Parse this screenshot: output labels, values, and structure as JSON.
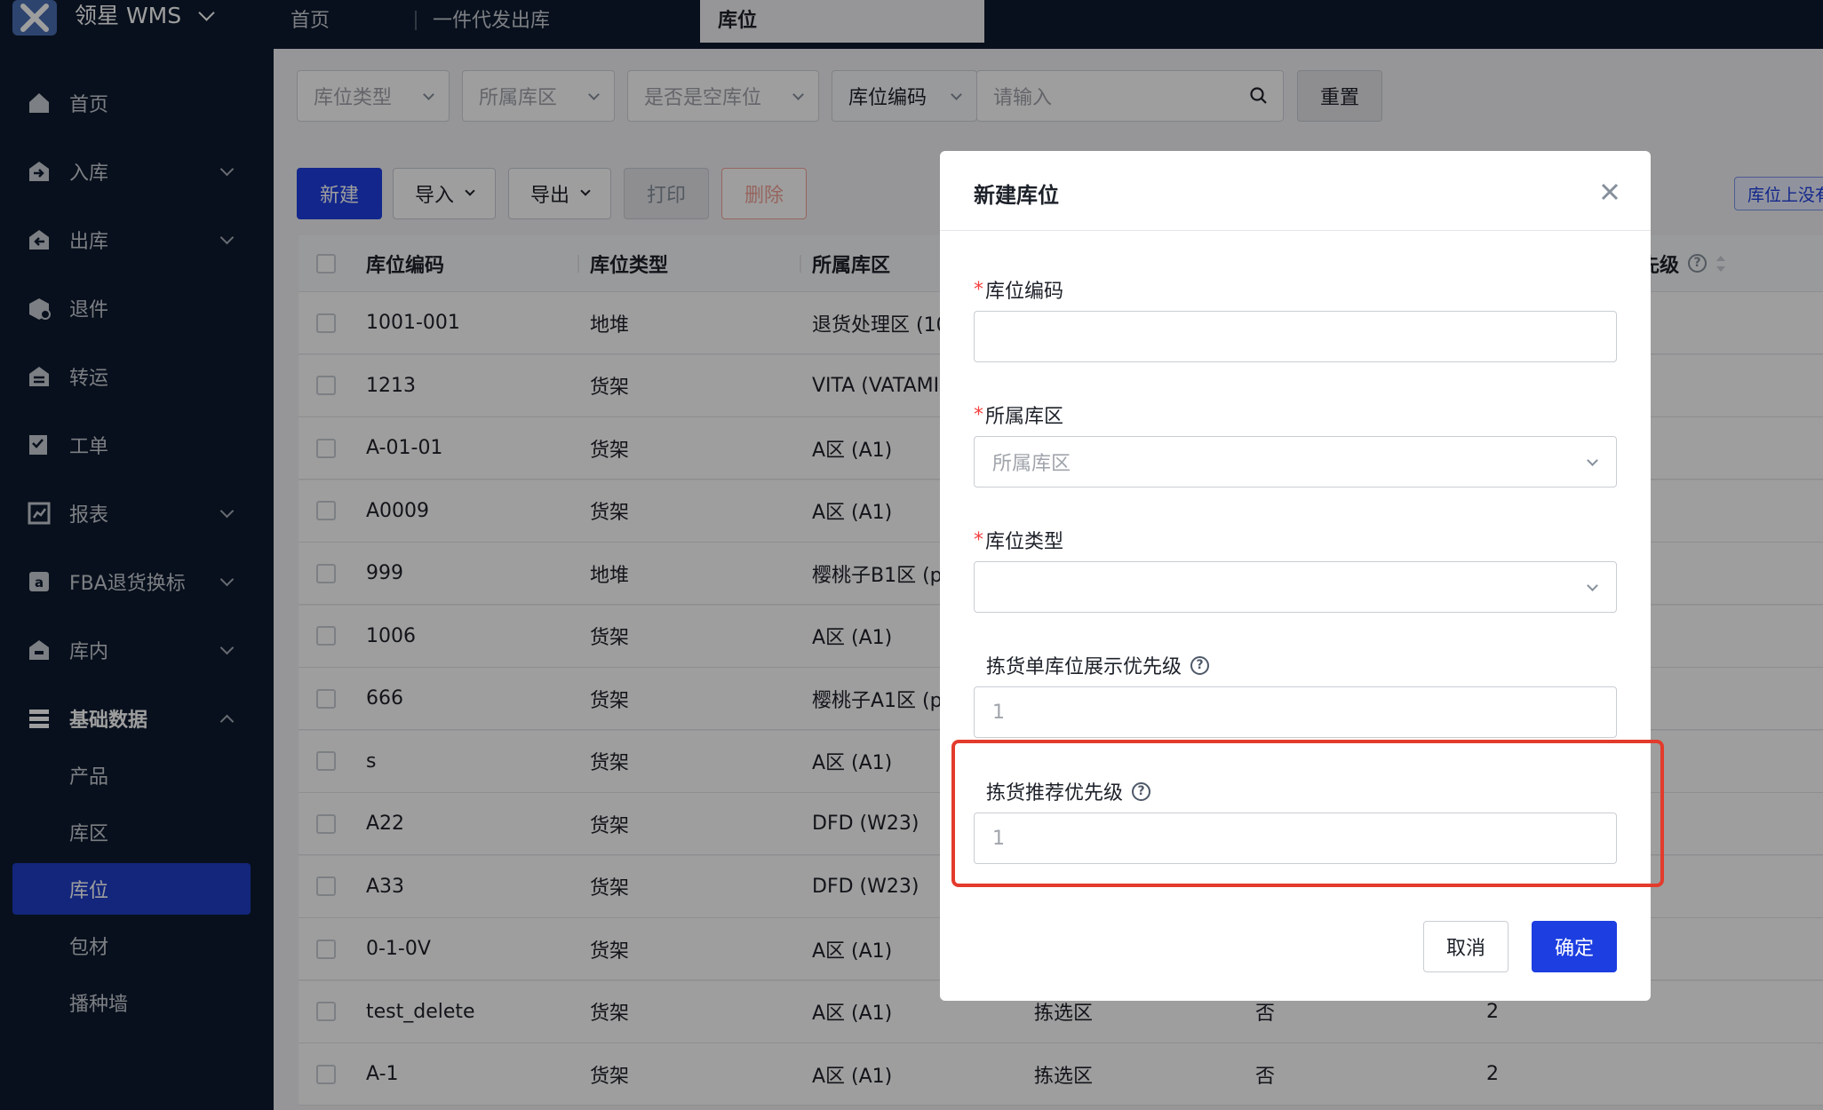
{
  "app": {
    "name": "领星 WMS"
  },
  "top_tabs": [
    {
      "label": "首页"
    },
    {
      "label": "一件代发出库"
    },
    {
      "label": "库位"
    }
  ],
  "sidebar": {
    "items": [
      {
        "label": "首页",
        "icon": "home-icon",
        "has_arrow": false
      },
      {
        "label": "入库",
        "icon": "inbound-icon",
        "has_arrow": true
      },
      {
        "label": "出库",
        "icon": "outbound-icon",
        "has_arrow": true
      },
      {
        "label": "退件",
        "icon": "return-icon",
        "has_arrow": false
      },
      {
        "label": "转运",
        "icon": "transfer-icon",
        "has_arrow": false
      },
      {
        "label": "工单",
        "icon": "workorder-icon",
        "has_arrow": false
      },
      {
        "label": "报表",
        "icon": "report-icon",
        "has_arrow": true
      },
      {
        "label": "FBA退货换标",
        "icon": "amazon-icon",
        "has_arrow": true
      },
      {
        "label": "库内",
        "icon": "warehouse-icon",
        "has_arrow": true
      },
      {
        "label": "基础数据",
        "icon": "basic-data-icon",
        "has_arrow": true
      }
    ],
    "sub_items": [
      {
        "label": "产品"
      },
      {
        "label": "库区"
      },
      {
        "label": "库位"
      },
      {
        "label": "包材"
      },
      {
        "label": "播种墙"
      }
    ]
  },
  "filters": {
    "location_type": "库位类型",
    "zone": "所属库区",
    "is_empty": "是否是空库位",
    "code_select": "库位编码",
    "search_placeholder": "请输入",
    "reset": "重置"
  },
  "toolbar": {
    "new": "新建",
    "import": "导入",
    "export": "导出",
    "print": "打印",
    "delete": "删除",
    "right_link": "库位上没有"
  },
  "table": {
    "headers": [
      "库位编码",
      "库位类型",
      "所属库区",
      "",
      "",
      "先级"
    ],
    "rows": [
      {
        "code": "1001-001",
        "type": "地堆",
        "zone": "退货处理区 (10",
        "area": "",
        "empty": "",
        "prio": ""
      },
      {
        "code": "1213",
        "type": "货架",
        "zone": "VITA (VATAMI",
        "area": "",
        "empty": "",
        "prio": ""
      },
      {
        "code": "A-01-01",
        "type": "货架",
        "zone": "A区 (A1)",
        "area": "",
        "empty": "",
        "prio": ""
      },
      {
        "code": "A0009",
        "type": "货架",
        "zone": "A区 (A1)",
        "area": "",
        "empty": "",
        "prio": ""
      },
      {
        "code": "999",
        "type": "地堆",
        "zone": "樱桃子B1区 (p",
        "area": "",
        "empty": "",
        "prio": ""
      },
      {
        "code": "1006",
        "type": "货架",
        "zone": "A区 (A1)",
        "area": "",
        "empty": "",
        "prio": ""
      },
      {
        "code": "666",
        "type": "货架",
        "zone": "樱桃子A1区 (p",
        "area": "",
        "empty": "",
        "prio": ""
      },
      {
        "code": "s",
        "type": "货架",
        "zone": "A区 (A1)",
        "area": "",
        "empty": "",
        "prio": ""
      },
      {
        "code": "A22",
        "type": "货架",
        "zone": "DFD (W23)",
        "area": "",
        "empty": "",
        "prio": ""
      },
      {
        "code": "A33",
        "type": "货架",
        "zone": "DFD (W23)",
        "area": "",
        "empty": "",
        "prio": ""
      },
      {
        "code": "0-1-0V",
        "type": "货架",
        "zone": "A区 (A1)",
        "area": "",
        "empty": "",
        "prio": ""
      },
      {
        "code": "test_delete",
        "type": "货架",
        "zone": "A区 (A1)",
        "area": "拣选区",
        "empty": "否",
        "prio": "2"
      },
      {
        "code": "A-1",
        "type": "货架",
        "zone": "A区 (A1)",
        "area": "拣选区",
        "empty": "否",
        "prio": "2"
      }
    ]
  },
  "modal": {
    "title": "新建库位",
    "fields": {
      "code_label": "库位编码",
      "code_value": "",
      "zone_label": "所属库区",
      "zone_placeholder": "所属库区",
      "type_label": "库位类型",
      "type_value": "",
      "pick_display_label": "拣货单库位展示优先级",
      "pick_display_value": "1",
      "pick_recommend_label": "拣货推荐优先级",
      "pick_recommend_value": "1"
    },
    "cancel": "取消",
    "confirm": "确定"
  },
  "colors": {
    "primary": "#1d3ee0",
    "sidebar_bg": "#0e1a2f",
    "highlight_border": "#e33b2c",
    "required": "#f53f3f"
  }
}
